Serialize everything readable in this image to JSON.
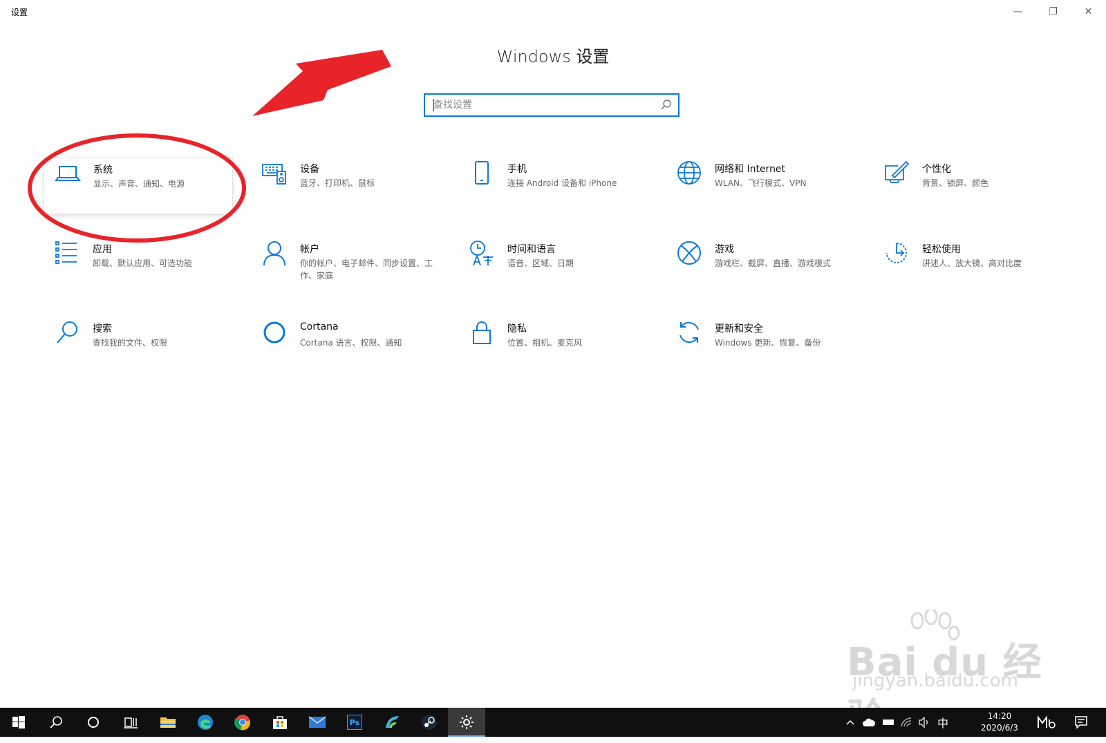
{
  "window": {
    "title": "设置",
    "minimize_glyph": "—",
    "restore_glyph": "❐",
    "close_glyph": "✕"
  },
  "header": {
    "title": "Windows 设置",
    "search_placeholder": "查找设置"
  },
  "tiles": [
    {
      "title": "系统",
      "desc": "显示、声音、通知、电源",
      "icon": "laptop-icon"
    },
    {
      "title": "设备",
      "desc": "蓝牙、打印机、鼠标",
      "icon": "devices-icon"
    },
    {
      "title": "手机",
      "desc": "连接 Android 设备和 iPhone",
      "icon": "phone-icon"
    },
    {
      "title": "网络和 Internet",
      "desc": "WLAN、飞行模式、VPN",
      "icon": "globe-icon"
    },
    {
      "title": "个性化",
      "desc": "背景、锁屏、颜色",
      "icon": "personalization-icon"
    },
    {
      "title": "应用",
      "desc": "卸载、默认应用、可选功能",
      "icon": "apps-list-icon"
    },
    {
      "title": "帐户",
      "desc": "你的帐户、电子邮件、同步设置、工作、家庭",
      "icon": "person-icon"
    },
    {
      "title": "时间和语言",
      "desc": "语音、区域、日期",
      "icon": "time-language-icon"
    },
    {
      "title": "游戏",
      "desc": "游戏栏、截屏、直播、游戏模式",
      "icon": "xbox-icon"
    },
    {
      "title": "轻松使用",
      "desc": "讲述人、放大镜、高对比度",
      "icon": "ease-of-access-icon"
    },
    {
      "title": "搜索",
      "desc": "查找我的文件、权限",
      "icon": "search-icon"
    },
    {
      "title": "Cortana",
      "desc": "Cortana 语言、权限、通知",
      "icon": "cortana-icon"
    },
    {
      "title": "隐私",
      "desc": "位置、相机、麦克风",
      "icon": "lock-icon"
    },
    {
      "title": "更新和安全",
      "desc": "Windows 更新、恢复、备份",
      "icon": "update-icon"
    }
  ],
  "colors": {
    "accent": "#0a78d7",
    "annotation": "#e8232a",
    "taskbar": "#101010"
  },
  "watermark": {
    "brand": "Bai du 经验",
    "url": "jingyan.baidu.com"
  },
  "taskbar": {
    "apps": [
      "start-icon",
      "search-icon",
      "cortana-icon",
      "task-view-icon",
      "file-explorer-icon",
      "edge-icon",
      "chrome-icon",
      "store-icon",
      "mail-icon",
      "photoshop-icon",
      "app-icon",
      "steam-icon",
      "settings-icon"
    ],
    "ps_label": "Ps",
    "ime": "中",
    "time": "14:20",
    "date": "2020/6/3"
  }
}
